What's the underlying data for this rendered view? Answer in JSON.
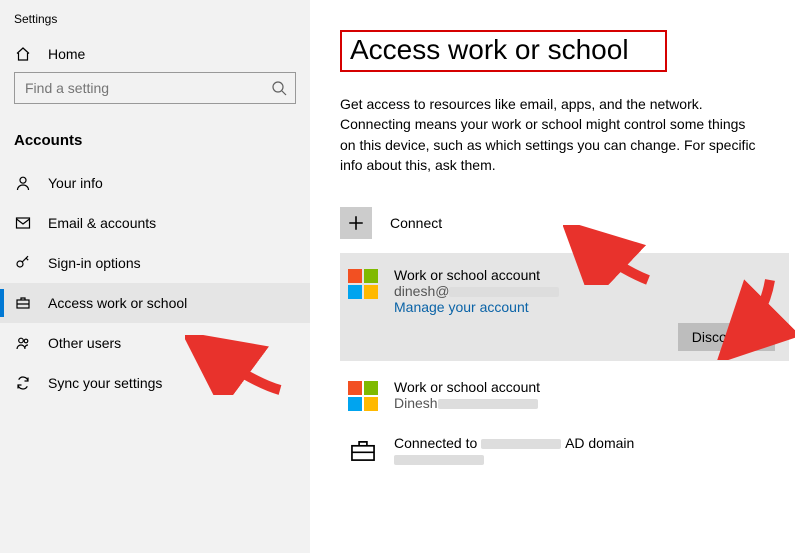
{
  "app_title": "Settings",
  "sidebar": {
    "home_label": "Home",
    "search_placeholder": "Find a setting",
    "section_header": "Accounts",
    "items": [
      {
        "label": "Your info"
      },
      {
        "label": "Email & accounts"
      },
      {
        "label": "Sign-in options"
      },
      {
        "label": "Access work or school"
      },
      {
        "label": "Other users"
      },
      {
        "label": "Sync your settings"
      }
    ]
  },
  "page": {
    "title": "Access work or school",
    "description": "Get access to resources like email, apps, and the network. Connecting means your work or school might control some things on this device, such as which settings you can change. For specific info about this, ask them.",
    "connect_label": "Connect",
    "accounts": [
      {
        "title": "Work or school account",
        "email_prefix": "dinesh@",
        "manage_label": "Manage your account",
        "disconnect_label": "Disconnect"
      },
      {
        "title": "Work or school account",
        "email_prefix": "Dinesh"
      }
    ],
    "domain": {
      "prefix": "Connected to ",
      "suffix": "AD domain"
    }
  }
}
